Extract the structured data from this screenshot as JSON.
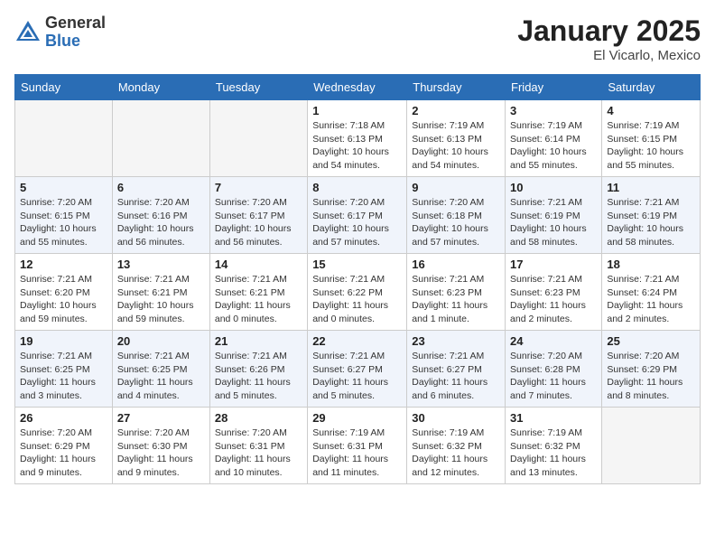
{
  "header": {
    "logo_general": "General",
    "logo_blue": "Blue",
    "month_title": "January 2025",
    "location": "El Vicarlo, Mexico"
  },
  "days_of_week": [
    "Sunday",
    "Monday",
    "Tuesday",
    "Wednesday",
    "Thursday",
    "Friday",
    "Saturday"
  ],
  "weeks": [
    [
      {
        "day": "",
        "info": ""
      },
      {
        "day": "",
        "info": ""
      },
      {
        "day": "",
        "info": ""
      },
      {
        "day": "1",
        "info": "Sunrise: 7:18 AM\nSunset: 6:13 PM\nDaylight: 10 hours and 54 minutes."
      },
      {
        "day": "2",
        "info": "Sunrise: 7:19 AM\nSunset: 6:13 PM\nDaylight: 10 hours and 54 minutes."
      },
      {
        "day": "3",
        "info": "Sunrise: 7:19 AM\nSunset: 6:14 PM\nDaylight: 10 hours and 55 minutes."
      },
      {
        "day": "4",
        "info": "Sunrise: 7:19 AM\nSunset: 6:15 PM\nDaylight: 10 hours and 55 minutes."
      }
    ],
    [
      {
        "day": "5",
        "info": "Sunrise: 7:20 AM\nSunset: 6:15 PM\nDaylight: 10 hours and 55 minutes."
      },
      {
        "day": "6",
        "info": "Sunrise: 7:20 AM\nSunset: 6:16 PM\nDaylight: 10 hours and 56 minutes."
      },
      {
        "day": "7",
        "info": "Sunrise: 7:20 AM\nSunset: 6:17 PM\nDaylight: 10 hours and 56 minutes."
      },
      {
        "day": "8",
        "info": "Sunrise: 7:20 AM\nSunset: 6:17 PM\nDaylight: 10 hours and 57 minutes."
      },
      {
        "day": "9",
        "info": "Sunrise: 7:20 AM\nSunset: 6:18 PM\nDaylight: 10 hours and 57 minutes."
      },
      {
        "day": "10",
        "info": "Sunrise: 7:21 AM\nSunset: 6:19 PM\nDaylight: 10 hours and 58 minutes."
      },
      {
        "day": "11",
        "info": "Sunrise: 7:21 AM\nSunset: 6:19 PM\nDaylight: 10 hours and 58 minutes."
      }
    ],
    [
      {
        "day": "12",
        "info": "Sunrise: 7:21 AM\nSunset: 6:20 PM\nDaylight: 10 hours and 59 minutes."
      },
      {
        "day": "13",
        "info": "Sunrise: 7:21 AM\nSunset: 6:21 PM\nDaylight: 10 hours and 59 minutes."
      },
      {
        "day": "14",
        "info": "Sunrise: 7:21 AM\nSunset: 6:21 PM\nDaylight: 11 hours and 0 minutes."
      },
      {
        "day": "15",
        "info": "Sunrise: 7:21 AM\nSunset: 6:22 PM\nDaylight: 11 hours and 0 minutes."
      },
      {
        "day": "16",
        "info": "Sunrise: 7:21 AM\nSunset: 6:23 PM\nDaylight: 11 hours and 1 minute."
      },
      {
        "day": "17",
        "info": "Sunrise: 7:21 AM\nSunset: 6:23 PM\nDaylight: 11 hours and 2 minutes."
      },
      {
        "day": "18",
        "info": "Sunrise: 7:21 AM\nSunset: 6:24 PM\nDaylight: 11 hours and 2 minutes."
      }
    ],
    [
      {
        "day": "19",
        "info": "Sunrise: 7:21 AM\nSunset: 6:25 PM\nDaylight: 11 hours and 3 minutes."
      },
      {
        "day": "20",
        "info": "Sunrise: 7:21 AM\nSunset: 6:25 PM\nDaylight: 11 hours and 4 minutes."
      },
      {
        "day": "21",
        "info": "Sunrise: 7:21 AM\nSunset: 6:26 PM\nDaylight: 11 hours and 5 minutes."
      },
      {
        "day": "22",
        "info": "Sunrise: 7:21 AM\nSunset: 6:27 PM\nDaylight: 11 hours and 5 minutes."
      },
      {
        "day": "23",
        "info": "Sunrise: 7:21 AM\nSunset: 6:27 PM\nDaylight: 11 hours and 6 minutes."
      },
      {
        "day": "24",
        "info": "Sunrise: 7:20 AM\nSunset: 6:28 PM\nDaylight: 11 hours and 7 minutes."
      },
      {
        "day": "25",
        "info": "Sunrise: 7:20 AM\nSunset: 6:29 PM\nDaylight: 11 hours and 8 minutes."
      }
    ],
    [
      {
        "day": "26",
        "info": "Sunrise: 7:20 AM\nSunset: 6:29 PM\nDaylight: 11 hours and 9 minutes."
      },
      {
        "day": "27",
        "info": "Sunrise: 7:20 AM\nSunset: 6:30 PM\nDaylight: 11 hours and 9 minutes."
      },
      {
        "day": "28",
        "info": "Sunrise: 7:20 AM\nSunset: 6:31 PM\nDaylight: 11 hours and 10 minutes."
      },
      {
        "day": "29",
        "info": "Sunrise: 7:19 AM\nSunset: 6:31 PM\nDaylight: 11 hours and 11 minutes."
      },
      {
        "day": "30",
        "info": "Sunrise: 7:19 AM\nSunset: 6:32 PM\nDaylight: 11 hours and 12 minutes."
      },
      {
        "day": "31",
        "info": "Sunrise: 7:19 AM\nSunset: 6:32 PM\nDaylight: 11 hours and 13 minutes."
      },
      {
        "day": "",
        "info": ""
      }
    ]
  ]
}
